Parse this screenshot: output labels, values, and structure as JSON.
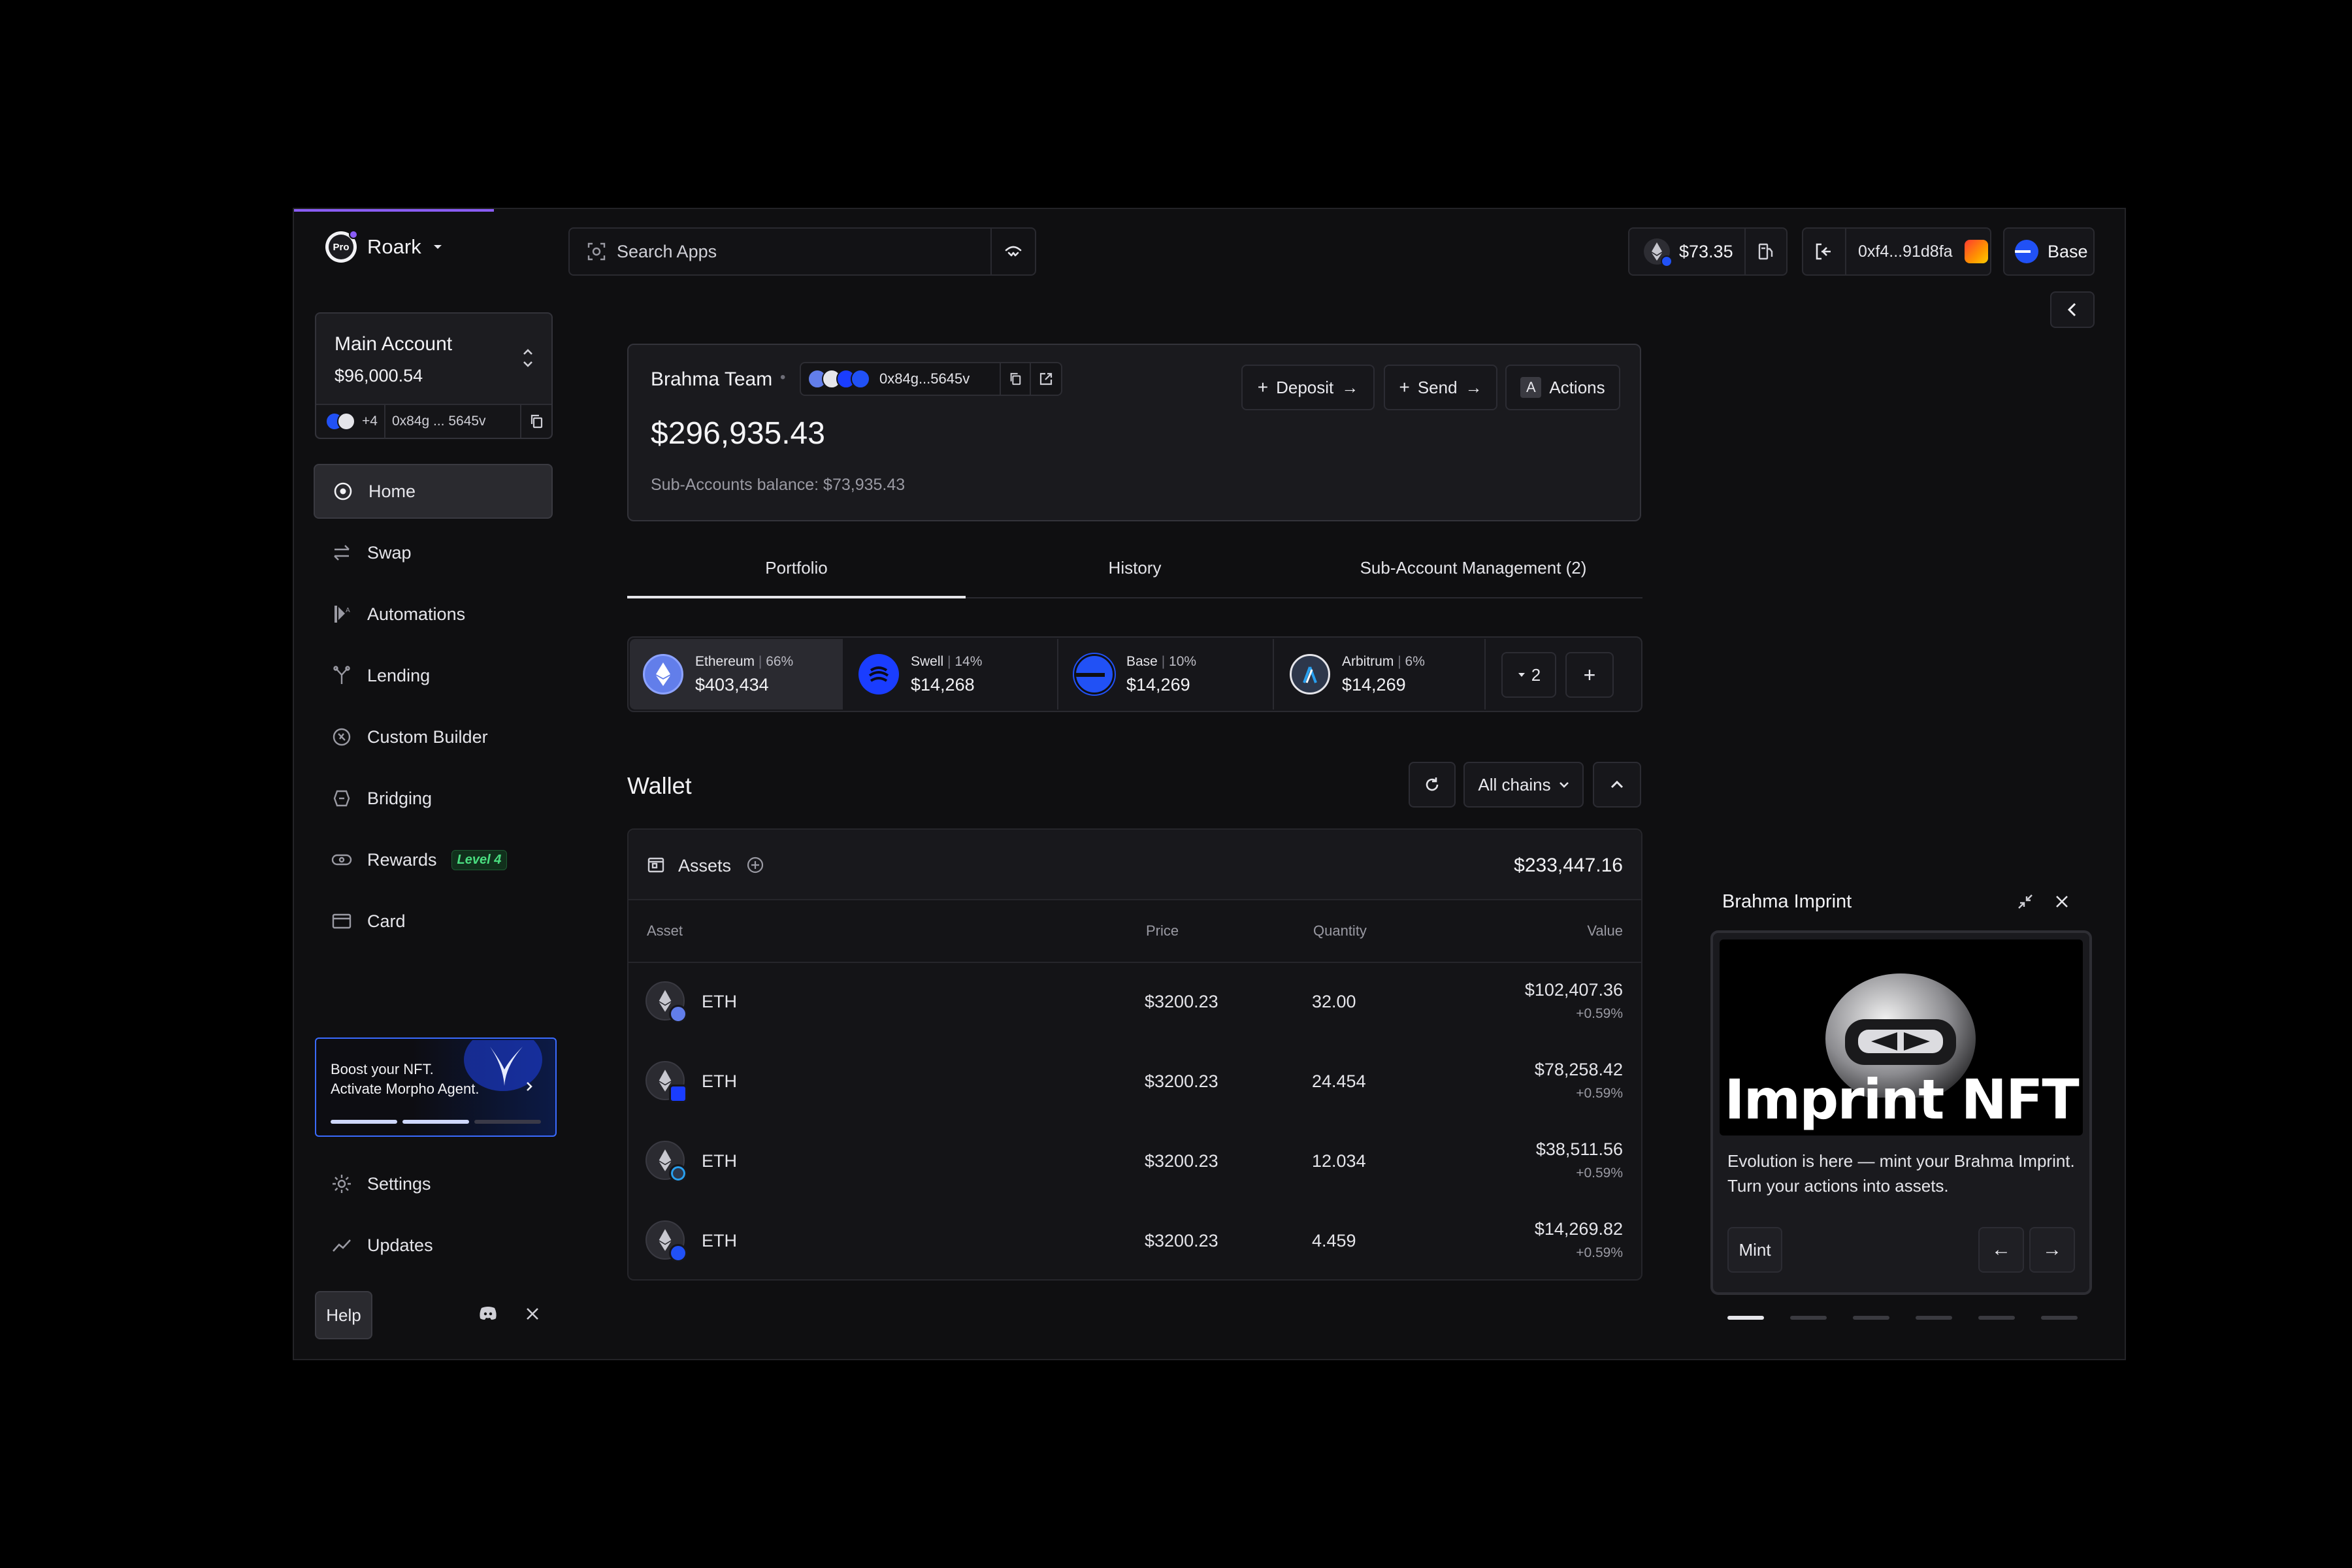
{
  "app": {
    "org_name": "Roark",
    "org_badge": "Pro"
  },
  "search": {
    "placeholder": "Search Apps"
  },
  "topbar": {
    "balance": "$73.35",
    "address": "0xf4...91d8fa",
    "network": "Base"
  },
  "account": {
    "name": "Main Account",
    "balance": "$96,000.54",
    "member_count": "+4",
    "address": "0x84g ... 5645v"
  },
  "sidebar": {
    "items": [
      {
        "label": "Home",
        "icon": "home-icon"
      },
      {
        "label": "Swap",
        "icon": "swap-icon"
      },
      {
        "label": "Automations",
        "icon": "automations-icon"
      },
      {
        "label": "Lending",
        "icon": "lending-icon"
      },
      {
        "label": "Custom Builder",
        "icon": "custom-builder-icon"
      },
      {
        "label": "Bridging",
        "icon": "bridging-icon"
      },
      {
        "label": "Rewards",
        "icon": "rewards-icon",
        "badge": "Level 4"
      },
      {
        "label": "Card",
        "icon": "card-icon"
      }
    ],
    "promo": {
      "line1": "Boost your NFT.",
      "line2": "Activate Morpho Agent.",
      "progress_segments": 3,
      "progress_filled": 2
    },
    "settings_label": "Settings",
    "updates_label": "Updates",
    "help_label": "Help"
  },
  "team": {
    "name": "Brahma Team",
    "address": "0x84g...5645v",
    "balance": "$296,935.43",
    "sub_balance": "Sub-Accounts balance: $73,935.43",
    "deposit_label": "Deposit",
    "send_label": "Send",
    "actions_label": "Actions",
    "actions_key": "A"
  },
  "tabs": [
    {
      "label": "Portfolio",
      "active": true
    },
    {
      "label": "History",
      "active": false
    },
    {
      "label": "Sub-Account Management (2)",
      "active": false
    }
  ],
  "chains": [
    {
      "name": "Ethereum",
      "pct": "66%",
      "value": "$403,434",
      "color": "#627eea",
      "icon": "ethereum-icon"
    },
    {
      "name": "Swell",
      "pct": "14%",
      "value": "$14,268",
      "color": "#1a3dff",
      "icon": "swell-icon"
    },
    {
      "name": "Base",
      "pct": "10%",
      "value": "$14,269",
      "color": "#2151f5",
      "icon": "base-icon"
    },
    {
      "name": "Arbitrum",
      "pct": "6%",
      "value": "$14,269",
      "color": "#2d374b",
      "icon": "arbitrum-icon"
    }
  ],
  "chains_more": "2",
  "wallet": {
    "title": "Wallet",
    "filter": "All chains",
    "assets_label": "Assets",
    "assets_total": "$233,447.16",
    "columns": [
      "Asset",
      "Price",
      "Quantity",
      "Value"
    ],
    "rows": [
      {
        "asset": "ETH",
        "price": "$3200.23",
        "qty": "32.00",
        "value": "$102,407.36",
        "change": "+0.59%",
        "chain_color": "#627eea"
      },
      {
        "asset": "ETH",
        "price": "$3200.23",
        "qty": "24.454",
        "value": "$78,258.42",
        "change": "+0.59%",
        "chain_color": "#1a3dff"
      },
      {
        "asset": "ETH",
        "price": "$3200.23",
        "qty": "12.034",
        "value": "$38,511.56",
        "change": "+0.59%",
        "chain_color": "#28a0f0"
      },
      {
        "asset": "ETH",
        "price": "$3200.23",
        "qty": "4.459",
        "value": "$14,269.82",
        "change": "+0.59%",
        "chain_color": "#2151f5"
      }
    ]
  },
  "imprint": {
    "title": "Brahma Imprint",
    "nft_text": "Imprint NFT",
    "desc_line1": "Evolution is here — mint your Brahma Imprint.",
    "desc_line2": "Turn your actions into assets.",
    "mint_label": "Mint",
    "pages": 6,
    "active_page": 1
  },
  "colors": {
    "accent": "#8a5cf6",
    "success": "#4ade80",
    "bg": "#0f0f11",
    "card": "#16161a"
  }
}
